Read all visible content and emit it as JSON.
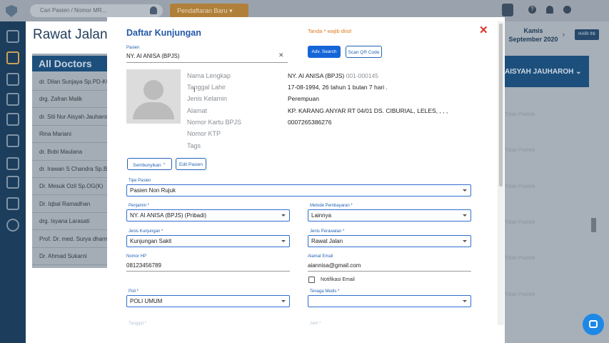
{
  "topbar": {
    "search_placeholder": "Cari Pasien / Nomor MR...",
    "daftar_label": "Pendaftaran Baru"
  },
  "background": {
    "title": "Rawat Jalan",
    "all_doctors": "All Doctors",
    "doctors": [
      "dr. Dilan Sunjaya Sp.PD-KG",
      "drg. Zafran Malik",
      "dr. Siti Nur Aisyah Jauharoh",
      "Rina Mariani",
      "dr. Bobi Maulana",
      "dr. Irawan S Chandra Sp.B",
      "Dr. Mesuk Ozil Sp.OG(K)",
      "Dr. Iqbal Ramadhan",
      "drg. Isyana Larasati",
      "Prof. Dr. med. Surya dharma",
      "Dr. Ahmad Sukarni"
    ],
    "date_day": "Kamis",
    "date_rest": "September 2020",
    "hari_ini": "HARI INI",
    "doctor_col": "AISYAH JAUHAROH",
    "tidak_praktek": "Tidak Praktek"
  },
  "modal": {
    "title": "Daftar Kunjungan",
    "required_note": "Tanda * wajib diisi!",
    "close_icon": "close-icon",
    "pasien_label": "Pasien",
    "pasien_value": "NY. AI ANISA (BPJS)",
    "adv_search": "Adv. Search",
    "scan_qr": "Scan QR Code",
    "info_labels": [
      "Nama Lengkap",
      "Tanggal Lahir",
      "Jenis Kelamin",
      "Alamat",
      "Nomor Kartu BPJS",
      "Nomor KTP",
      "Tags"
    ],
    "nama": "NY. AI ANISA (BPJS)",
    "mr": "001-000145",
    "tgl_lahir": "17-08-1994, 26 tahun 1 bulan 7 hari .",
    "jenis_kelamin": "Perempuan",
    "alamat": "KP. KARANG ANYAR RT 04/01 DS. CIBURIAL, LELES, , , ,",
    "bpjs": "0007265386276",
    "sembunyikan": "Sembunyikan",
    "edit_pasien": "Edit Pasien",
    "tipe_pasien_label": "Tipe Pasien",
    "tipe_pasien": "Pasien Non Rujuk",
    "penjamin_label": "Penjamin *",
    "penjamin": "NY. AI ANISA (BPJS) (Pribadi)",
    "metode_label": "Metode Pembayaran *",
    "metode": "Lainnya",
    "jenis_kunjungan_label": "Jenis Kunjungan *",
    "jenis_kunjungan": "Kunjungan Sakit",
    "jenis_perawatan_label": "Jenis Perawatan *",
    "jenis_perawatan": "Rawat Jalan",
    "hp_label": "Nomor HP",
    "hp": "08123456789",
    "email_label": "Alamat Email",
    "email": "aiannisa@gmail.com",
    "notif_email": "Notifikasi Email",
    "poli_label": "Poli *",
    "poli": "POLI UMUM",
    "tenaga_label": "Tenaga Medis *",
    "tanggal_label": "Tanggal *",
    "jam_label": "Jam *"
  }
}
